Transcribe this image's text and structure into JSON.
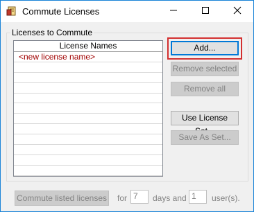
{
  "window": {
    "title": "Commute Licenses"
  },
  "icons": {
    "app": "license-app-icon",
    "minimize": "minimize-icon",
    "maximize": "maximize-icon",
    "close": "close-icon"
  },
  "group": {
    "label": "Licenses to Commute"
  },
  "list": {
    "header": "License Names",
    "rows": [
      "<new license name>",
      "",
      "",
      "",
      "",
      "",
      "",
      "",
      "",
      "",
      "",
      "",
      ""
    ]
  },
  "buttons": {
    "add": "Add...",
    "remove_selected": "Remove selected",
    "remove_all": "Remove all",
    "use_license_set": "Use License Set...",
    "save_as_set": "Save As Set..."
  },
  "footer": {
    "commute_button": "Commute listed licenses",
    "for_label": "for",
    "days_value": "7",
    "days_label": "days and",
    "users_value": "1",
    "users_label": "user(s)."
  },
  "colors": {
    "accent": "#0078d7",
    "highlight": "#d32f2f",
    "new_item_text": "#a00000"
  }
}
